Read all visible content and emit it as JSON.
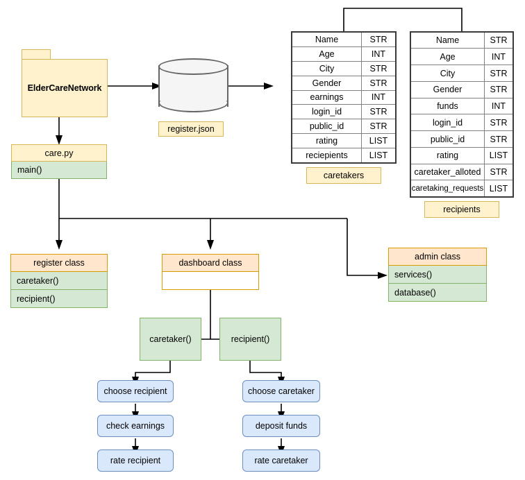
{
  "diagram": {
    "package": {
      "name": "ElderCareNetwork"
    },
    "datastore": {
      "label": "register.json"
    },
    "module": {
      "title": "care.py",
      "members": [
        "main()"
      ]
    },
    "tables": [
      {
        "caption": "caretakers",
        "rows": [
          {
            "field": "Name",
            "type": "STR"
          },
          {
            "field": "Age",
            "type": "INT"
          },
          {
            "field": "City",
            "type": "STR"
          },
          {
            "field": "Gender",
            "type": "STR"
          },
          {
            "field": "earnings",
            "type": "INT"
          },
          {
            "field": "login_id",
            "type": "STR"
          },
          {
            "field": "public_id",
            "type": "STR"
          },
          {
            "field": "rating",
            "type": "LIST"
          },
          {
            "field": "reciepients",
            "type": "LIST"
          }
        ]
      },
      {
        "caption": "recipients",
        "rows": [
          {
            "field": "Name",
            "type": "STR"
          },
          {
            "field": "Age",
            "type": "INT"
          },
          {
            "field": "City",
            "type": "STR"
          },
          {
            "field": "Gender",
            "type": "STR"
          },
          {
            "field": "funds",
            "type": "INT"
          },
          {
            "field": "login_id",
            "type": "STR"
          },
          {
            "field": "public_id",
            "type": "STR"
          },
          {
            "field": "rating",
            "type": "LIST"
          },
          {
            "field": "caretaker_alloted",
            "type": "STR"
          },
          {
            "field": "caretaking_requests",
            "type": "LIST"
          }
        ]
      }
    ],
    "classes": [
      {
        "name": "register class",
        "members": [
          "caretaker()",
          "recipient()"
        ]
      },
      {
        "name": "dashboard class",
        "members": []
      },
      {
        "name": "admin class",
        "members": [
          "services()",
          "database()"
        ]
      }
    ],
    "dashboard_methods": [
      "caretaker()",
      "recipient()"
    ],
    "flow_left": [
      "choose recipient",
      "check earnings",
      "rate recipient"
    ],
    "flow_right": [
      "choose caretaker",
      "deposit funds",
      "rate caretaker"
    ],
    "colors": {
      "yellow_fill": "#fff2cc",
      "yellow_stroke": "#d6b656",
      "orange_fill": "#ffe6cc",
      "orange_stroke": "#d79b00",
      "green_fill": "#d5e8d4",
      "green_stroke": "#82b366",
      "blue_fill": "#dae8fc",
      "blue_stroke": "#6c8ebf",
      "gray_fill": "#f5f5f5",
      "gray_stroke": "#666666",
      "line": "#000000"
    }
  }
}
